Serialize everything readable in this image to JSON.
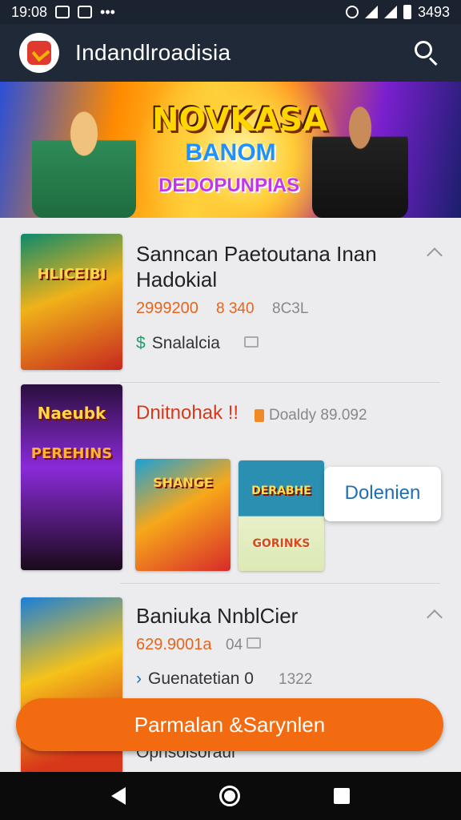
{
  "statusbar": {
    "time": "19:08",
    "battery": "3493"
  },
  "app": {
    "title": "Indandlroadisia"
  },
  "banner": {
    "title": "NOVKASA",
    "subtitle": "BANOM",
    "tagline": "DEDOPUNPIAS"
  },
  "items": [
    {
      "title_line1": "Sanncan Paetoutana Inan",
      "title_line2": "Hadokial",
      "price": "2999200",
      "meta1": "8 340",
      "meta2": "8C3L",
      "seller": "Snalalcia",
      "thumb_label": "HLICEIBI"
    },
    {
      "title": "Dnitnohak !!",
      "meta": "Doaldy 89.092",
      "thumb_label1": "Naeubk",
      "thumb_label2": "PEREHINS",
      "mini_thumb_label": "SHANGE",
      "chip_thumb_label1": "DERABHE",
      "chip_thumb_label2": "GORINKS",
      "action_label": "Dolenien"
    },
    {
      "title": "Baniuka NnblCier",
      "price": "629.9001a",
      "meta": "04",
      "seller": "Guenatetian 0",
      "seller_meta": "1322",
      "extra_text": "Opnsolsoraui"
    }
  ],
  "cta": {
    "label": "Parmalan &Sarynlen"
  },
  "colors": {
    "accent": "#f26b10",
    "appbar": "#1f2937",
    "link": "#1f6fb8",
    "price": "#e8641a"
  }
}
